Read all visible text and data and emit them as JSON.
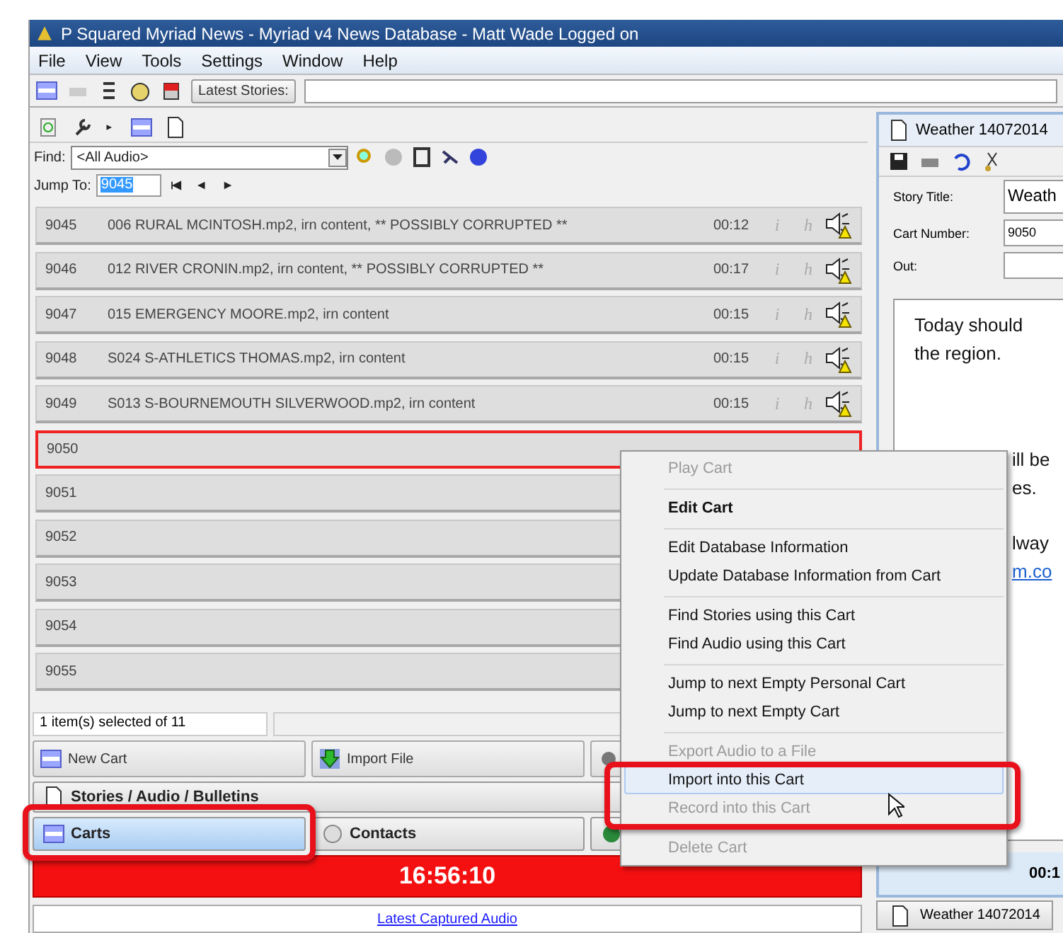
{
  "window": {
    "title": "P Squared Myriad News - Myriad v4 News Database - Matt Wade Logged on"
  },
  "menu_bar": [
    "File",
    "View",
    "Tools",
    "Settings",
    "Window",
    "Help"
  ],
  "toolbar": {
    "latest_stories_button": "Latest Stories:"
  },
  "find": {
    "label": "Find:",
    "value": "<All Audio>"
  },
  "jump_to": {
    "label": "Jump To:",
    "value": "9045"
  },
  "carts": [
    {
      "number": "9045",
      "title": "006 RURAL MCINTOSH.mp2, irn content, ** POSSIBLY CORRUPTED **",
      "duration": "00:12",
      "info": "i",
      "history": "h",
      "kind": "audio",
      "selected": false
    },
    {
      "number": "9046",
      "title": "012 RIVER CRONIN.mp2, irn content, ** POSSIBLY CORRUPTED **",
      "duration": "00:17",
      "info": "i",
      "history": "h",
      "kind": "audio",
      "selected": false
    },
    {
      "number": "9047",
      "title": "015 EMERGENCY MOORE.mp2, irn content",
      "duration": "00:15",
      "info": "i",
      "history": "h",
      "kind": "audio",
      "selected": false
    },
    {
      "number": "9048",
      "title": "S024 S-ATHLETICS THOMAS.mp2, irn content",
      "duration": "00:15",
      "info": "i",
      "history": "h",
      "kind": "audio",
      "selected": false
    },
    {
      "number": "9049",
      "title": "S013 S-BOURNEMOUTH SILVERWOOD.mp2, irn content",
      "duration": "00:15",
      "info": "i",
      "history": "h",
      "kind": "audio",
      "selected": false
    },
    {
      "number": "9050",
      "kind": "empty",
      "selected": true
    },
    {
      "number": "9051",
      "kind": "empty",
      "selected": false
    },
    {
      "number": "9052",
      "kind": "empty",
      "selected": false
    },
    {
      "number": "9053",
      "kind": "empty",
      "selected": false
    },
    {
      "number": "9054",
      "kind": "empty",
      "selected": false
    },
    {
      "number": "9055",
      "kind": "empty",
      "selected": false
    }
  ],
  "status": "1 item(s) selected of 11",
  "actions": [
    {
      "label": "New Cart",
      "kind": "cart"
    },
    {
      "label": "Import File",
      "kind": "import"
    }
  ],
  "nav": [
    {
      "label": "Stories / Audio / Bulletins",
      "kind": "stories",
      "selected": false
    },
    {
      "label": "Carts",
      "kind": "cart",
      "selected": true
    },
    {
      "label": "Contacts",
      "kind": "contacts",
      "selected": false
    }
  ],
  "clock": "16:56:10",
  "footer_link": "Latest Captured Audio",
  "story": {
    "title": "Weather 14072014",
    "title_label": "Story Title:",
    "title_value": "Weath",
    "cart_label": "Cart Number:",
    "cart_value": "9050",
    "out_label": "Out:",
    "paragraphs": [
      [
        {
          "text": "Today should",
          "kind": "text"
        },
        {
          "text": "the region.",
          "kind": "text"
        }
      ],
      [
        {
          "text": "ill be",
          "kind": "text"
        },
        {
          "text": "es.",
          "kind": "text"
        }
      ],
      [
        {
          "text": "lway",
          "kind": "text"
        },
        {
          "text": "m.co",
          "kind": "link"
        }
      ]
    ],
    "duration": "00:1"
  },
  "taskbar": [
    {
      "label": "Weather 14072014"
    }
  ],
  "context_menu": [
    {
      "kind": "item",
      "label": "Play Cart",
      "disabled": true,
      "default": false,
      "selected": false
    },
    {
      "kind": "separator"
    },
    {
      "kind": "item",
      "label": "Edit Cart",
      "disabled": false,
      "default": true,
      "selected": false
    },
    {
      "kind": "separator"
    },
    {
      "kind": "item",
      "label": "Edit Database Information",
      "disabled": false,
      "default": false,
      "selected": false
    },
    {
      "kind": "item",
      "label": "Update Database Information from Cart",
      "disabled": false,
      "default": false,
      "selected": false
    },
    {
      "kind": "separator"
    },
    {
      "kind": "item",
      "label": "Find Stories using this Cart",
      "disabled": false,
      "default": false,
      "selected": false
    },
    {
      "kind": "item",
      "label": "Find Audio using this Cart",
      "disabled": false,
      "default": false,
      "selected": false
    },
    {
      "kind": "separator"
    },
    {
      "kind": "item",
      "label": "Jump to next Empty Personal Cart",
      "disabled": false,
      "default": false,
      "selected": false
    },
    {
      "kind": "item",
      "label": "Jump to next Empty Cart",
      "disabled": false,
      "default": false,
      "selected": false
    },
    {
      "kind": "separator"
    },
    {
      "kind": "item",
      "label": "Export Audio to a File",
      "disabled": true,
      "default": false,
      "selected": false
    },
    {
      "kind": "item",
      "label": "Import into this Cart",
      "disabled": false,
      "default": false,
      "selected": true
    },
    {
      "kind": "item",
      "label": "Record into this Cart",
      "disabled": true,
      "default": false,
      "selected": false
    },
    {
      "kind": "separator"
    },
    {
      "kind": "item",
      "label": "Delete Cart",
      "disabled": true,
      "default": false,
      "selected": false
    }
  ]
}
